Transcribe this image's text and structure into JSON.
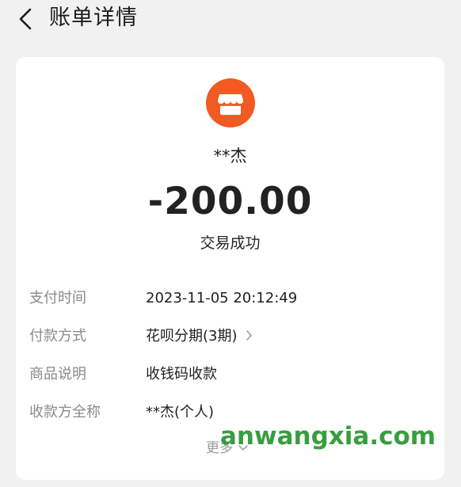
{
  "header": {
    "title": "账单详情",
    "back_icon": "chevron-left-icon"
  },
  "payee": {
    "avatar_icon": "storefront-icon",
    "avatar_color": "#f15a22",
    "name": "**杰"
  },
  "transaction": {
    "amount": "-200.00",
    "status": "交易成功"
  },
  "details": [
    {
      "label": "支付时间",
      "value": "2023-11-05 20:12:49"
    },
    {
      "label": "付款方式",
      "value": "花呗分期(3期)",
      "has_chevron": true
    },
    {
      "label": "商品说明",
      "value": "收钱码收款"
    },
    {
      "label": "收款方全称",
      "value": "**杰(个人)"
    }
  ],
  "more": {
    "label": "更多",
    "icon": "chevron-down-icon"
  },
  "watermark": {
    "text": "anwangxia.com",
    "color": "#269630"
  }
}
